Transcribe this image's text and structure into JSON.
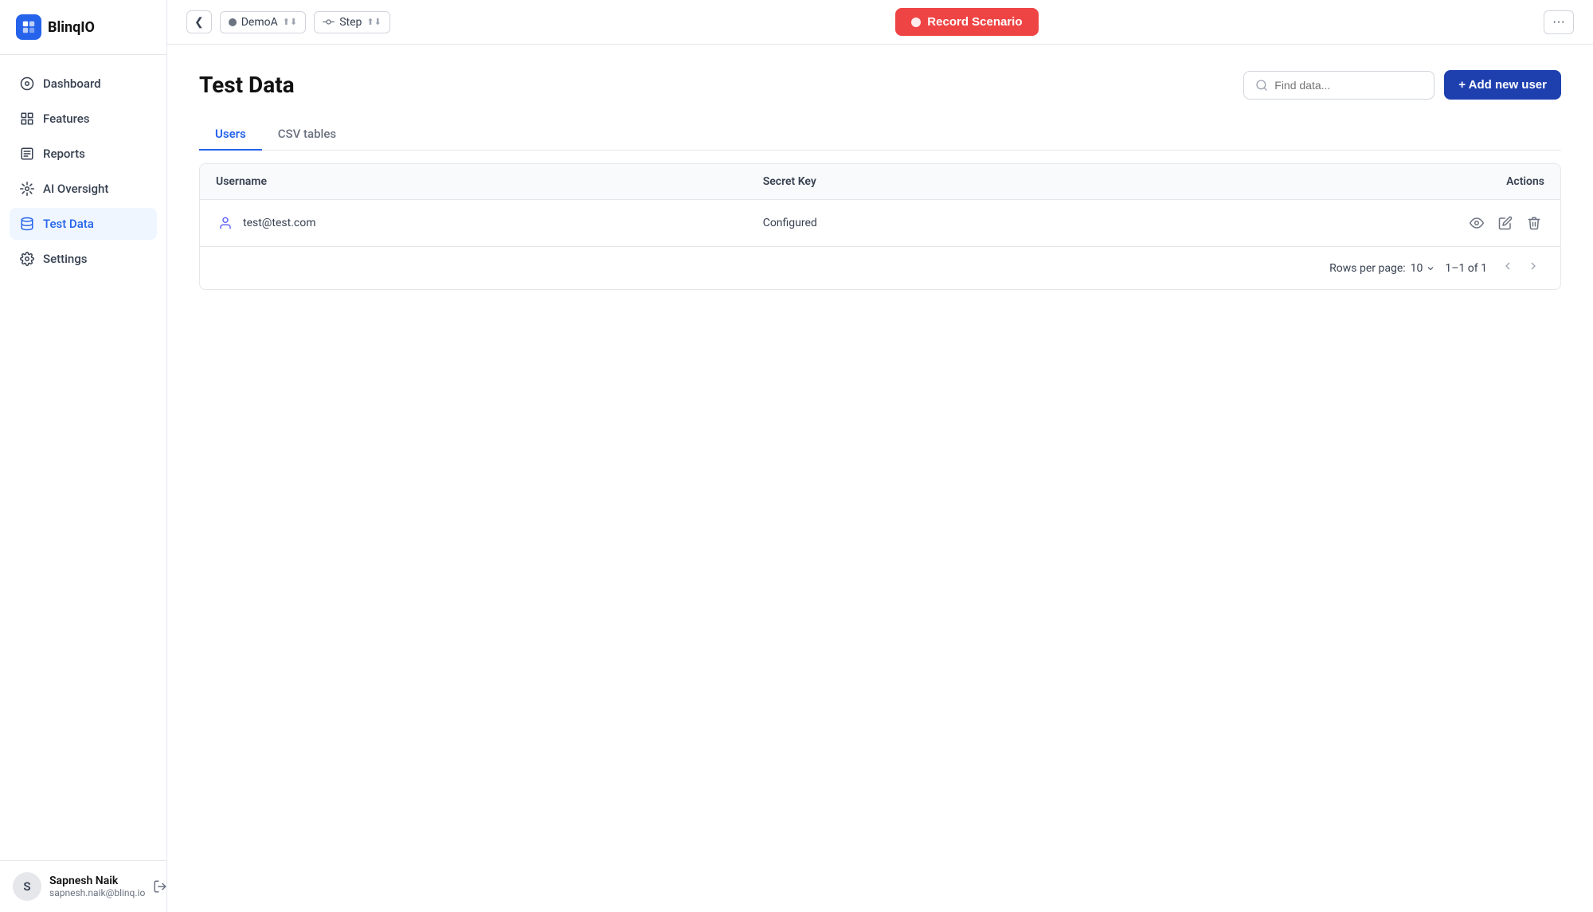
{
  "app": {
    "name": "BlinqIO",
    "logo_alt": "BlinqIO Logo"
  },
  "topbar": {
    "collapse_btn": "❮",
    "env_label": "DemoA",
    "step_label": "Step",
    "record_btn_label": "Record Scenario",
    "more_label": "···"
  },
  "sidebar": {
    "items": [
      {
        "id": "dashboard",
        "label": "Dashboard",
        "icon": "dashboard-icon",
        "active": false
      },
      {
        "id": "features",
        "label": "Features",
        "icon": "features-icon",
        "active": false
      },
      {
        "id": "reports",
        "label": "Reports",
        "icon": "reports-icon",
        "active": false
      },
      {
        "id": "ai-oversight",
        "label": "AI Oversight",
        "icon": "ai-oversight-icon",
        "active": false
      },
      {
        "id": "test-data",
        "label": "Test Data",
        "icon": "test-data-icon",
        "active": true
      },
      {
        "id": "settings",
        "label": "Settings",
        "icon": "settings-icon",
        "active": false
      }
    ],
    "footer": {
      "name": "Sapnesh Naik",
      "email": "sapnesh.naik@blinq.io",
      "avatar_initial": "S"
    }
  },
  "page": {
    "title": "Test Data",
    "search_placeholder": "Find data...",
    "add_btn_label": "+ Add new user"
  },
  "tabs": [
    {
      "id": "users",
      "label": "Users",
      "active": true
    },
    {
      "id": "csv-tables",
      "label": "CSV tables",
      "active": false
    }
  ],
  "table": {
    "headers": [
      "Username",
      "Secret Key",
      "Actions"
    ],
    "rows": [
      {
        "username": "test@test.com",
        "secret_key": "Configured"
      }
    ]
  },
  "pagination": {
    "rows_per_page_label": "Rows per page:",
    "rows_per_page_value": "10",
    "page_info": "1–1 of 1"
  },
  "actions": {
    "view_label": "View",
    "edit_label": "Edit",
    "delete_label": "Delete"
  }
}
